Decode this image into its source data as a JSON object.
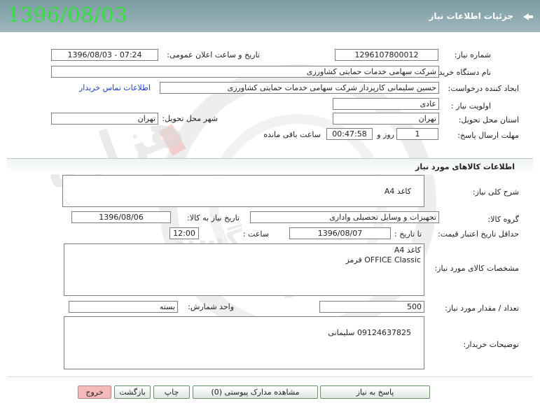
{
  "header": {
    "title": "جزئیات اطلاعات نیاز",
    "date": "1396/08/03"
  },
  "fields": {
    "need_number_label": "شماره نیاز:",
    "need_number": "1296107800012",
    "announce_label": "تاریخ و ساعت اعلان عمومی:",
    "announce_value": "1396/08/03 - 07:24",
    "buyer_label": "نام دستگاه خریدار:",
    "buyer_value": "شرکت سهامی خدمات حمایتی کشاورزی",
    "creator_label": "ایجاد کننده درخواست:",
    "creator_value": "حسین سلیمانی کارپرداز شرکت سهامی خدمات حمایتی کشاورزی",
    "contact_link": "اطلاعات تماس خریدار",
    "priority_label": "اولویت نیاز :",
    "priority_value": "",
    "priority_box": "عادی",
    "province_label": "استان محل تحویل:",
    "province_value": "تهران",
    "city_label": "شهر محل تحویل:",
    "city_value": "تهران",
    "deadline_label": "مهلت ارسال پاسخ:",
    "deadline_days": "1",
    "days_word": "روز و",
    "deadline_time": "00:47:58",
    "remaining_word": "ساعت باقی مانده"
  },
  "goods": {
    "section_title": "اطلاعات کالاهای مورد نیاز",
    "desc_label": "شرح کلی نیاز:",
    "desc_value": "کاغذ A4",
    "group_label": "گروه کالا:",
    "group_value": "تجهیزات و وسایل تحصیلی واداری",
    "need_date_label": "تاریخ نیاز به کالا:",
    "need_date_value": "1396/08/06",
    "validity_label": "حداقل تاریخ اعتبار قیمت:",
    "until_date_label": "تا تاریخ :",
    "until_date_value": "1396/08/07",
    "time_label": "ساعت :",
    "time_value": "12:00",
    "specs_label": "مشخصات کالای مورد نیاز:",
    "specs_line1": "کاغذ A4",
    "specs_line2": "OFFICE Classic  قرمز",
    "qty_label": "تعداد / مقدار مورد نیاز:",
    "qty_value": "500",
    "unit_label": "واحد شمارش:",
    "unit_value": "بسته",
    "notes_label": "توضیحات خریدار:",
    "notes_value": "09124637825 سلیمانی"
  },
  "buttons": {
    "reply": "پاسخ به نیاز",
    "attachments": "مشاهده مدارک پیوستی (0)",
    "print": "چاپ",
    "back": "بازگشت",
    "exit": "خروج"
  },
  "watermark": {
    "line1": "هزاره",
    "line2": "گستر",
    "line3": "ارتباط"
  },
  "colors": {
    "header_bg": "#8aa7ae",
    "date_green": "#33e13b",
    "link_blue": "#1a3cc9",
    "exit_bg": "#f6b9b9"
  }
}
